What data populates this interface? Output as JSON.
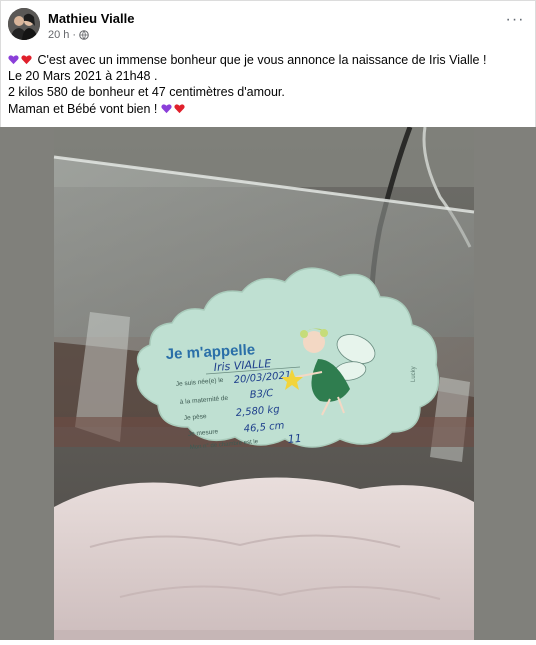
{
  "post": {
    "author": "Mathieu Vialle",
    "time": "20 h",
    "separator": "·",
    "lines": [
      "C'est avec un immense bonheur que je vous annonce la naissance de Iris Vialle !",
      "Le 20 Mars 2021 à 21h48 .",
      "2 kilos 580 de bonheur et 47 centimètres d'amour.",
      "Maman et Bébé vont bien !"
    ],
    "more_label": "···"
  },
  "card": {
    "title": "Je m'appelle",
    "name": "Iris VIALLE",
    "fields": [
      {
        "label": "Je suis née(e) le",
        "value": "20/03/2021"
      },
      {
        "label": "à la maternité de",
        "value": "B3/C"
      },
      {
        "label": "Je pèse",
        "value": "2,580 kg"
      },
      {
        "label": "Je mesure",
        "value": "46,5 cm"
      },
      {
        "label": "Mon n° de chambre est le",
        "value": "11"
      }
    ],
    "brand": "Lucky"
  },
  "colors": {
    "card_bg": "#bfe0d2",
    "card_title": "#2a6fa8",
    "fairy_green": "#2f7d4f",
    "heart_purple": "#8b3fd9",
    "heart_red": "#e0202c"
  }
}
